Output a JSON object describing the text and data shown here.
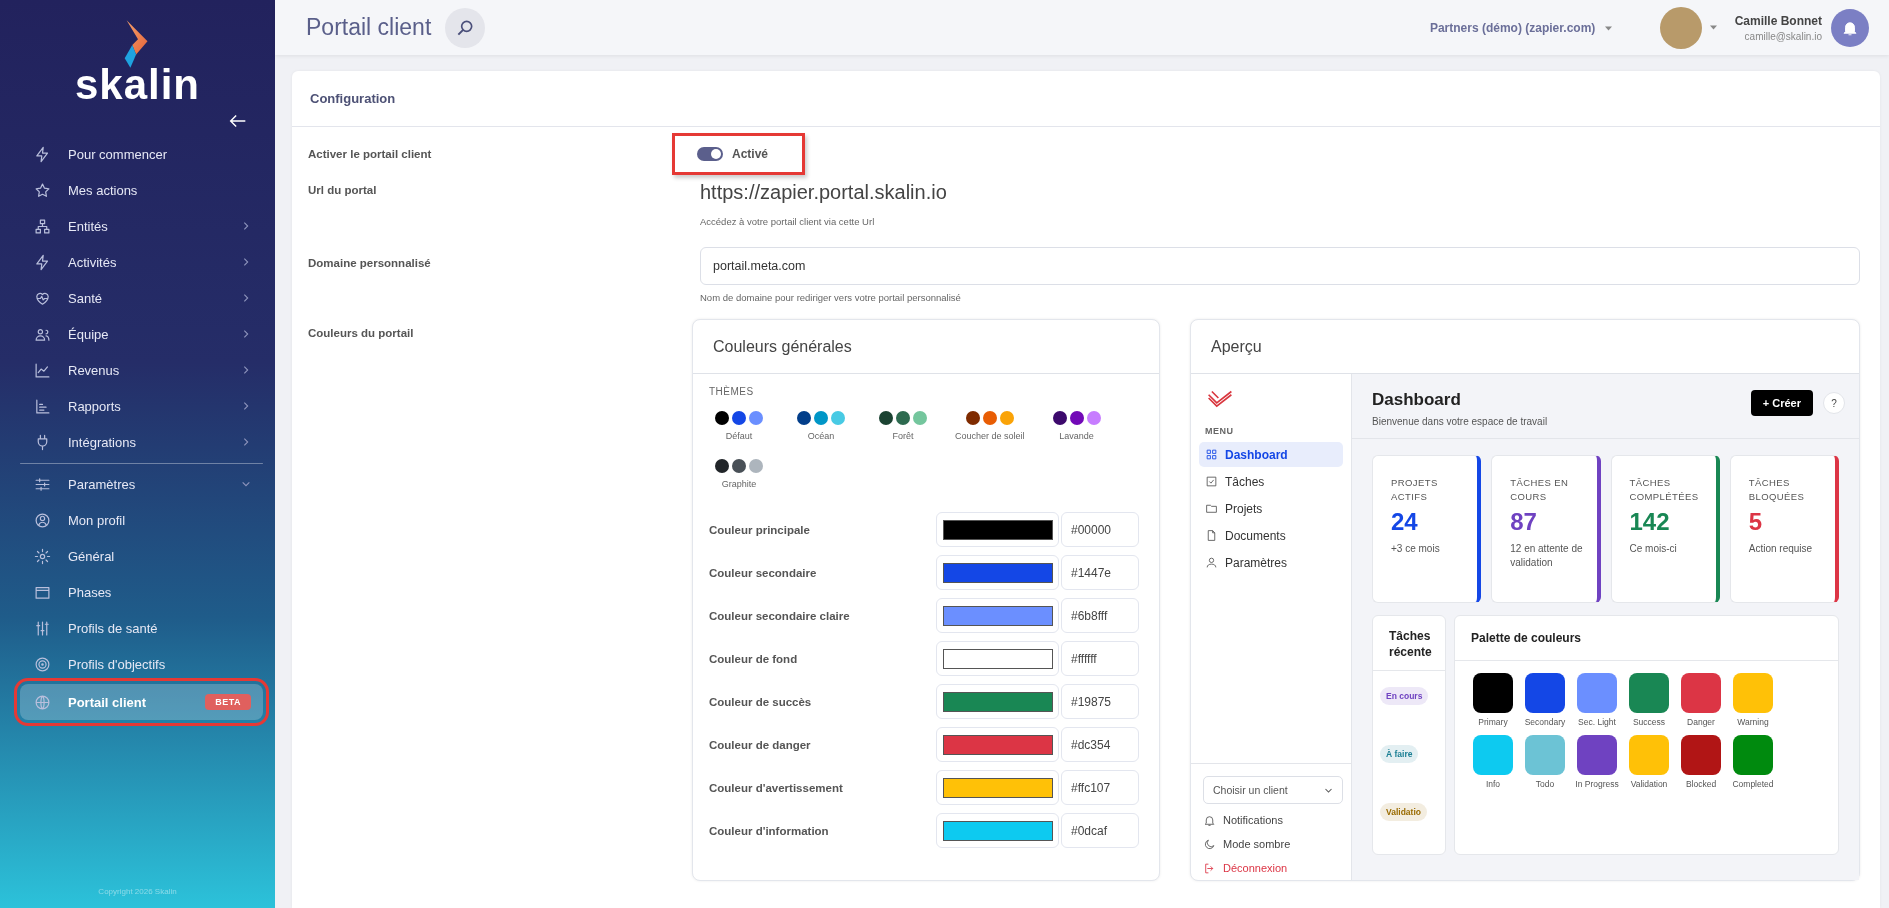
{
  "sidebar": {
    "logo": "skalin",
    "items": [
      {
        "label": "Pour commencer",
        "kind": "link",
        "selected": false
      },
      {
        "label": "Mes actions",
        "kind": "link",
        "selected": false
      },
      {
        "label": "Entités",
        "kind": "group",
        "expanded": false,
        "selected": false
      },
      {
        "label": "Activités",
        "kind": "group",
        "expanded": false,
        "selected": false
      },
      {
        "label": "Santé",
        "kind": "group",
        "expanded": false,
        "selected": false
      },
      {
        "label": "Équipe",
        "kind": "group",
        "expanded": false,
        "selected": false
      },
      {
        "label": "Revenus",
        "kind": "group",
        "expanded": false,
        "selected": false
      },
      {
        "label": "Rapports",
        "kind": "group",
        "expanded": false,
        "selected": false
      },
      {
        "label": "Intégrations",
        "kind": "group",
        "expanded": false,
        "selected": false
      },
      {
        "label": "Paramètres",
        "kind": "group",
        "expanded": true,
        "selected": false,
        "children": [
          {
            "label": "Mon profil",
            "selected": false,
            "highlighted": false
          },
          {
            "label": "Général",
            "selected": false,
            "highlighted": false
          },
          {
            "label": "Phases",
            "selected": false,
            "highlighted": false
          },
          {
            "label": "Profils de santé",
            "selected": false,
            "highlighted": false
          },
          {
            "label": "Profils d'objectifs",
            "selected": false,
            "highlighted": false
          },
          {
            "label": "Portail client",
            "selected": true,
            "highlighted": true,
            "badge": "BETA"
          }
        ]
      }
    ],
    "copyright": "Copyright 2026 Skalin"
  },
  "header": {
    "title": "Portail client",
    "workspace": "Partners (démo) (zapier.com)",
    "user": {
      "name": "Camille Bonnet",
      "email": "camille@skalin.io"
    }
  },
  "configuration": {
    "title": "Configuration",
    "activation": {
      "label": "Activer le portail client",
      "on": true,
      "status": "Activé",
      "highlighted": true
    },
    "url": {
      "label": "Url du portal",
      "value": "https://zapier.portal.skalin.io",
      "hint": "Accédez à votre portail client via cette Url"
    },
    "domain": {
      "label": "Domaine personnalisé",
      "value": "portail.meta.com",
      "hint": "Nom de domaine pour rediriger vers votre portail personnalisé"
    },
    "colors": {
      "label": "Couleurs du portail",
      "general": {
        "title": "Couleurs générales",
        "themes_title": "THÈMES",
        "themes": [
          {
            "name": "Défaut",
            "dots": [
              {
                "color": "#000000"
              },
              {
                "color": "#1447e6"
              },
              {
                "color": "#6b8fff"
              }
            ]
          },
          {
            "name": "Océan",
            "dots": [
              {
                "color": "#023e8a"
              },
              {
                "color": "#0096c7"
              },
              {
                "color": "#48cae4"
              }
            ]
          },
          {
            "name": "Forêt",
            "dots": [
              {
                "color": "#1b4332"
              },
              {
                "color": "#2d6a4f"
              },
              {
                "color": "#74c69d"
              }
            ]
          },
          {
            "name": "Coucher de soleil",
            "dots": [
              {
                "color": "#7f2b00"
              },
              {
                "color": "#e85d04"
              },
              {
                "color": "#faa307"
              }
            ]
          },
          {
            "name": "Lavande",
            "dots": [
              {
                "color": "#3c096c"
              },
              {
                "color": "#7209b7"
              },
              {
                "color": "#c77dff"
              }
            ]
          },
          {
            "name": "Graphite",
            "dots": [
              {
                "color": "#212529"
              },
              {
                "color": "#495057"
              },
              {
                "color": "#adb5bd"
              }
            ]
          }
        ],
        "fields": [
          {
            "label": "Couleur principale",
            "color": "#000000",
            "value": "#00000"
          },
          {
            "label": "Couleur secondaire",
            "color": "#1447e6",
            "value": "#1447e"
          },
          {
            "label": "Couleur secondaire claire",
            "color": "#6b8fff",
            "value": "#6b8fff"
          },
          {
            "label": "Couleur de fond",
            "color": "#ffffff",
            "value": "#ffffff"
          },
          {
            "label": "Couleur de succès",
            "color": "#198754",
            "value": "#19875"
          },
          {
            "label": "Couleur de danger",
            "color": "#dc3545",
            "value": "#dc354"
          },
          {
            "label": "Couleur d'avertissement",
            "color": "#ffc107",
            "value": "#ffc107"
          },
          {
            "label": "Couleur d'information",
            "color": "#0dcaf0",
            "value": "#0dcaf"
          }
        ]
      },
      "preview": {
        "title": "Aperçu",
        "menu_title": "MENU",
        "menu": [
          {
            "label": "Dashboard",
            "selected": true
          },
          {
            "label": "Tâches",
            "selected": false
          },
          {
            "label": "Projets",
            "selected": false
          },
          {
            "label": "Documents",
            "selected": false
          },
          {
            "label": "Paramètres",
            "selected": false
          }
        ],
        "client_select": {
          "placeholder": "Choisir un client"
        },
        "footer_links": [
          {
            "label": "Notifications",
            "kind": "normal"
          },
          {
            "label": "Mode sombre",
            "kind": "normal"
          },
          {
            "label": "Déconnexion",
            "kind": "danger"
          }
        ],
        "dashboard": {
          "title": "Dashboard",
          "subtitle": "Bienvenue dans votre espace de travail",
          "create_button": "+ Créer",
          "help_button": "?"
        },
        "stats": [
          {
            "label": "PROJETS ACTIFS",
            "value": "24",
            "note": "+3 ce mois",
            "color": "#1447e6"
          },
          {
            "label": "TÂCHES EN COURS",
            "value": "87",
            "note": "12 en attente de validation",
            "color": "#6f42c1"
          },
          {
            "label": "TÂCHES COMPLÉTÉES",
            "value": "142",
            "note": "Ce mois-ci",
            "color": "#198754"
          },
          {
            "label": "TÂCHES BLOQUÉES",
            "value": "5",
            "note": "Action requise",
            "color": "#dc3545"
          }
        ],
        "tasks": {
          "title": "Tâches récente",
          "badges": [
            {
              "label": "En cours",
              "color": "#6f42c1"
            },
            {
              "label": "À faire",
              "color": "#1a7f94"
            },
            {
              "label": "Validatio",
              "color": "#9a6b00"
            }
          ]
        },
        "palette": {
          "title": "Palette de couleurs",
          "swatches": [
            {
              "label": "Primary",
              "color": "#000000"
            },
            {
              "label": "Secondary",
              "color": "#1447e6"
            },
            {
              "label": "Sec. Light",
              "color": "#6b8fff"
            },
            {
              "label": "Success",
              "color": "#198754"
            },
            {
              "label": "Danger",
              "color": "#dc3545"
            },
            {
              "label": "Warning",
              "color": "#ffc107"
            },
            {
              "label": "Info",
              "color": "#0dcaf0"
            },
            {
              "label": "Todo",
              "color": "#6cc3d5"
            },
            {
              "label": "In Progress",
              "color": "#6f42c1"
            },
            {
              "label": "Validation",
              "color": "#ffc107"
            },
            {
              "label": "Blocked",
              "color": "#b11515"
            },
            {
              "label": "Completed",
              "color": "#008a0e"
            }
          ]
        }
      }
    }
  }
}
